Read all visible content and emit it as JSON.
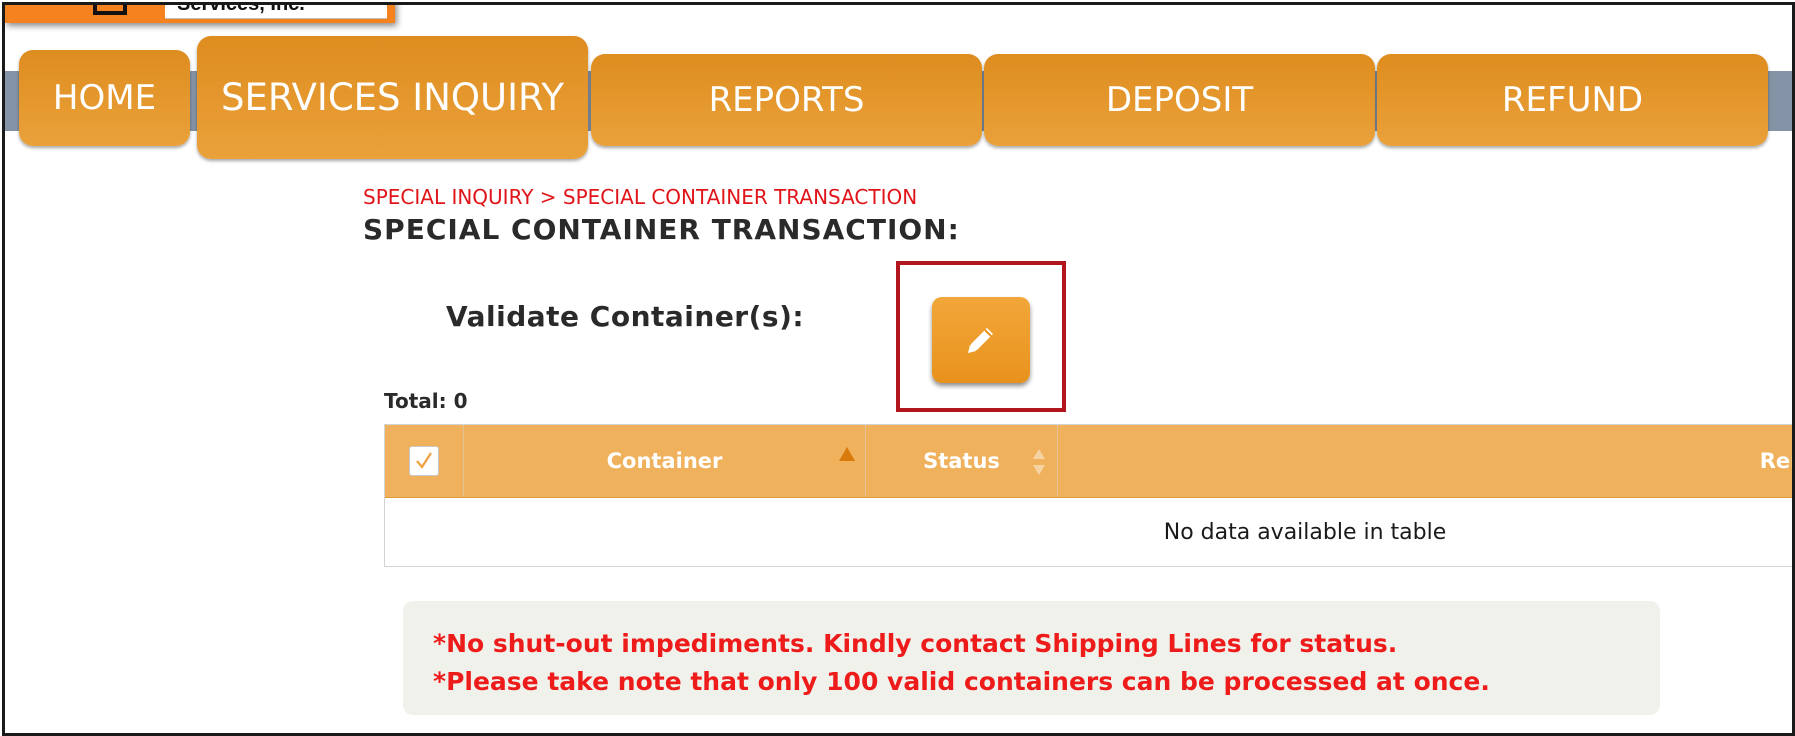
{
  "logo": {
    "text": "Services, Inc."
  },
  "nav": {
    "tabs": [
      {
        "label": "HOME"
      },
      {
        "label": "SERVICES INQUIRY"
      },
      {
        "label": "REPORTS"
      },
      {
        "label": "DEPOSIT"
      },
      {
        "label": "REFUND"
      }
    ],
    "active": "SERVICES INQUIRY"
  },
  "breadcrumb": "SPECIAL INQUIRY > SPECIAL CONTAINER TRANSACTION",
  "page_title": "SPECIAL CONTAINER TRANSACTION:",
  "validate": {
    "label": "Validate Container(s):",
    "button_icon": "pencil-icon"
  },
  "total": {
    "label": "Total:",
    "value": "0"
  },
  "table": {
    "columns": [
      "Container",
      "Status",
      "Rem"
    ],
    "empty_message": "No data available in table"
  },
  "notes": [
    "*No shut-out impediments. Kindly contact Shipping Lines for status.",
    "*Please take note that only 100 valid containers can be processed at once."
  ],
  "colors": {
    "accent": "#e8921c",
    "breadcrumb": "#e0151a",
    "note_text": "#ee1b1b",
    "highlight_border": "#b3151f",
    "header_bg": "#f0b15c"
  }
}
